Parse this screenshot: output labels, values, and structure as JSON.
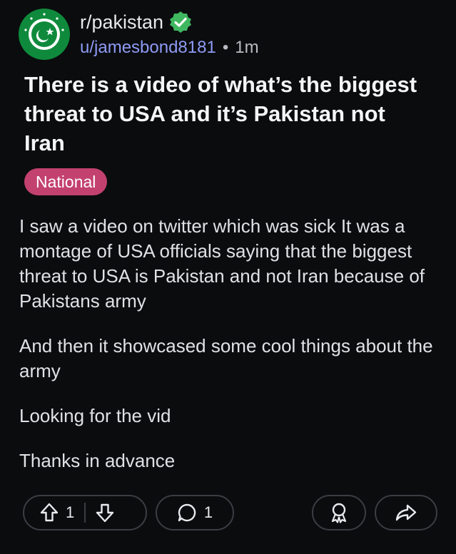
{
  "post": {
    "subreddit": "r/pakistan",
    "username": "u/jamesbond8181",
    "separator": "•",
    "age": "1m",
    "title": "There is a video of what’s the biggest threat to USA and it’s Pakistan not Iran",
    "flair": "National",
    "body": [
      "I saw a video on twitter which was sick It was a montage of USA officials saying that the biggest threat to USA is Pakistan and not Iran because of Pakistans army",
      "And then it showcased some cool things about the army",
      "Looking for the vid",
      "Thanks in advance"
    ]
  },
  "actions": {
    "upvotes": "1",
    "comments": "1"
  },
  "colors": {
    "background": "#0b0c0e",
    "username": "#8e9bf5",
    "flair": "#c3416f",
    "verified": "#3fb760",
    "avatar": "#0f8a3c"
  },
  "icons": [
    "subreddit-avatar-icon",
    "verified-badge-icon",
    "upvote-icon",
    "downvote-icon",
    "comment-icon",
    "award-icon",
    "share-icon"
  ]
}
